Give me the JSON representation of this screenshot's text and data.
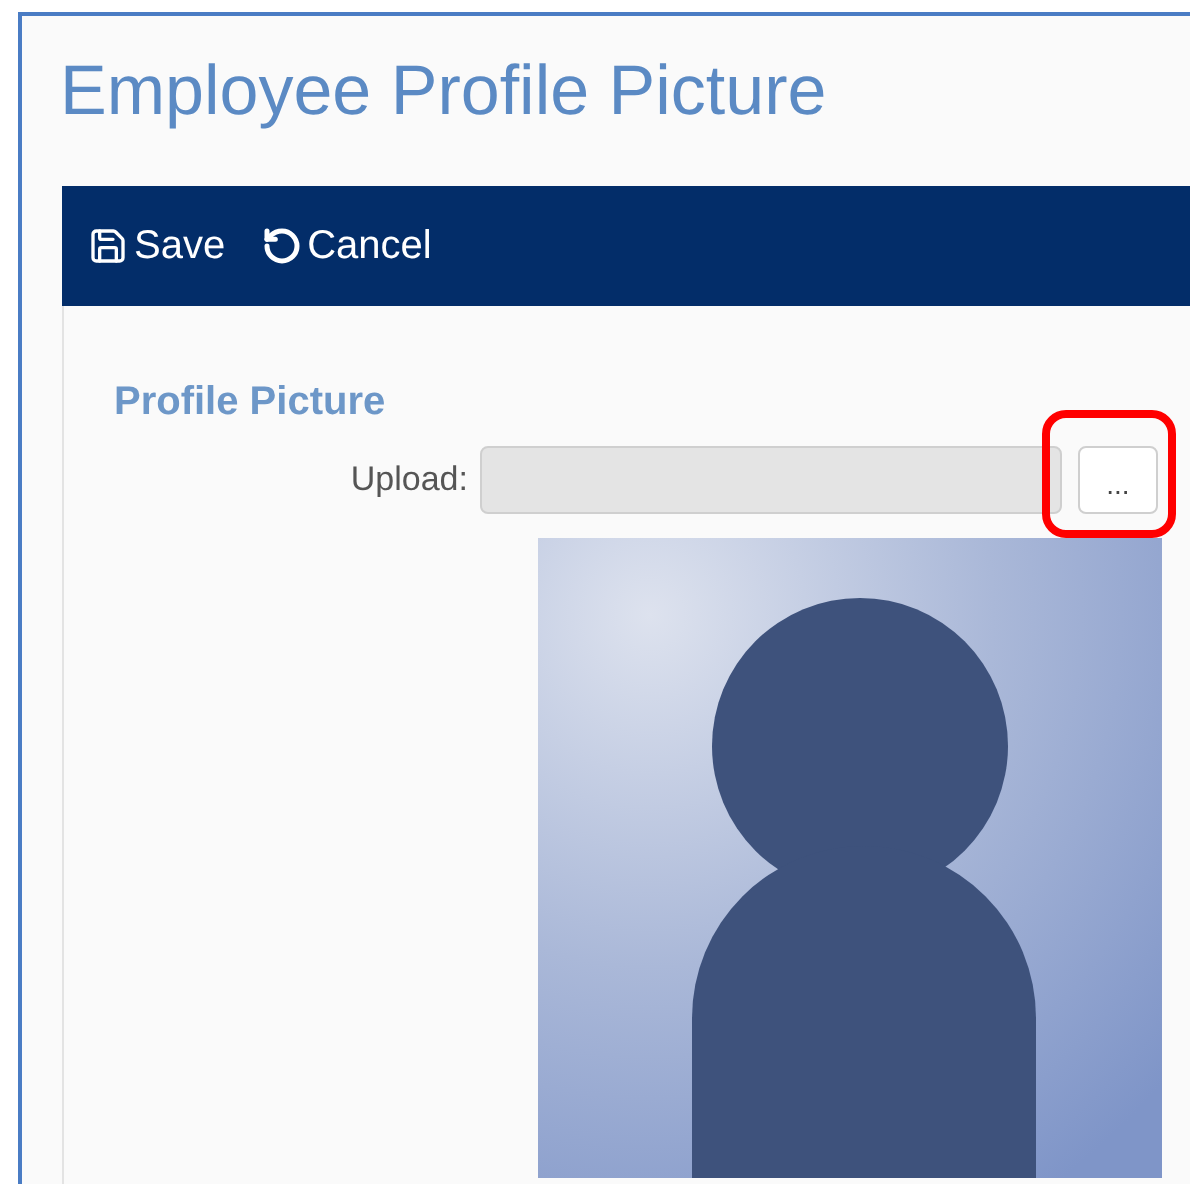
{
  "title": "Employee Profile Picture",
  "toolbar": [
    {
      "label": "Save",
      "kind": "save"
    },
    {
      "label": "Cancel",
      "kind": "cancel"
    }
  ],
  "section": {
    "heading": "Profile Picture",
    "upload": {
      "label": "Upload:",
      "browse_button": {
        "label": "...",
        "highlighted": true
      }
    },
    "photo": {
      "kind": "silhouette"
    }
  }
}
